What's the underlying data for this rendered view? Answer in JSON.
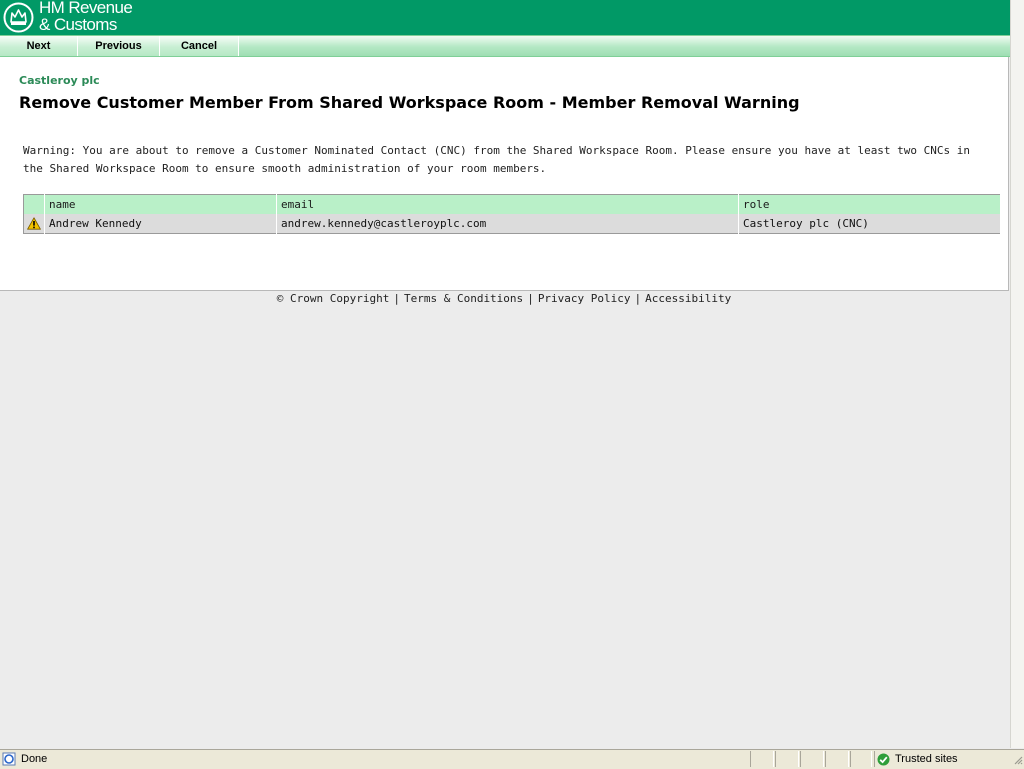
{
  "brand": {
    "line1": "HM Revenue",
    "line2": "& Customs",
    "color": "#019966"
  },
  "nav": {
    "next": "Next",
    "previous": "Previous",
    "cancel": "Cancel"
  },
  "page": {
    "organisation": "Castleroy plc",
    "title": "Remove Customer Member From Shared Workspace Room - Member Removal Warning",
    "warning": "Warning: You are about to remove a Customer Nominated Contact (CNC) from the Shared Workspace Room. Please ensure you have at least two CNCs in the Shared Workspace Room to ensure smooth administration of your room members."
  },
  "table": {
    "headers": [
      "name",
      "email",
      "role"
    ],
    "rows": [
      {
        "icon": "warning-icon",
        "name": "Andrew Kennedy",
        "email": "andrew.kennedy@castleroyplc.com",
        "role": "Castleroy plc (CNC)"
      }
    ]
  },
  "footer": {
    "copyright": "© Crown Copyright",
    "terms": "Terms & Conditions",
    "privacy": "Privacy Policy",
    "accessibility": "Accessibility",
    "separator": "|"
  },
  "statusbar": {
    "status": "Done",
    "zone": "Trusted sites"
  }
}
